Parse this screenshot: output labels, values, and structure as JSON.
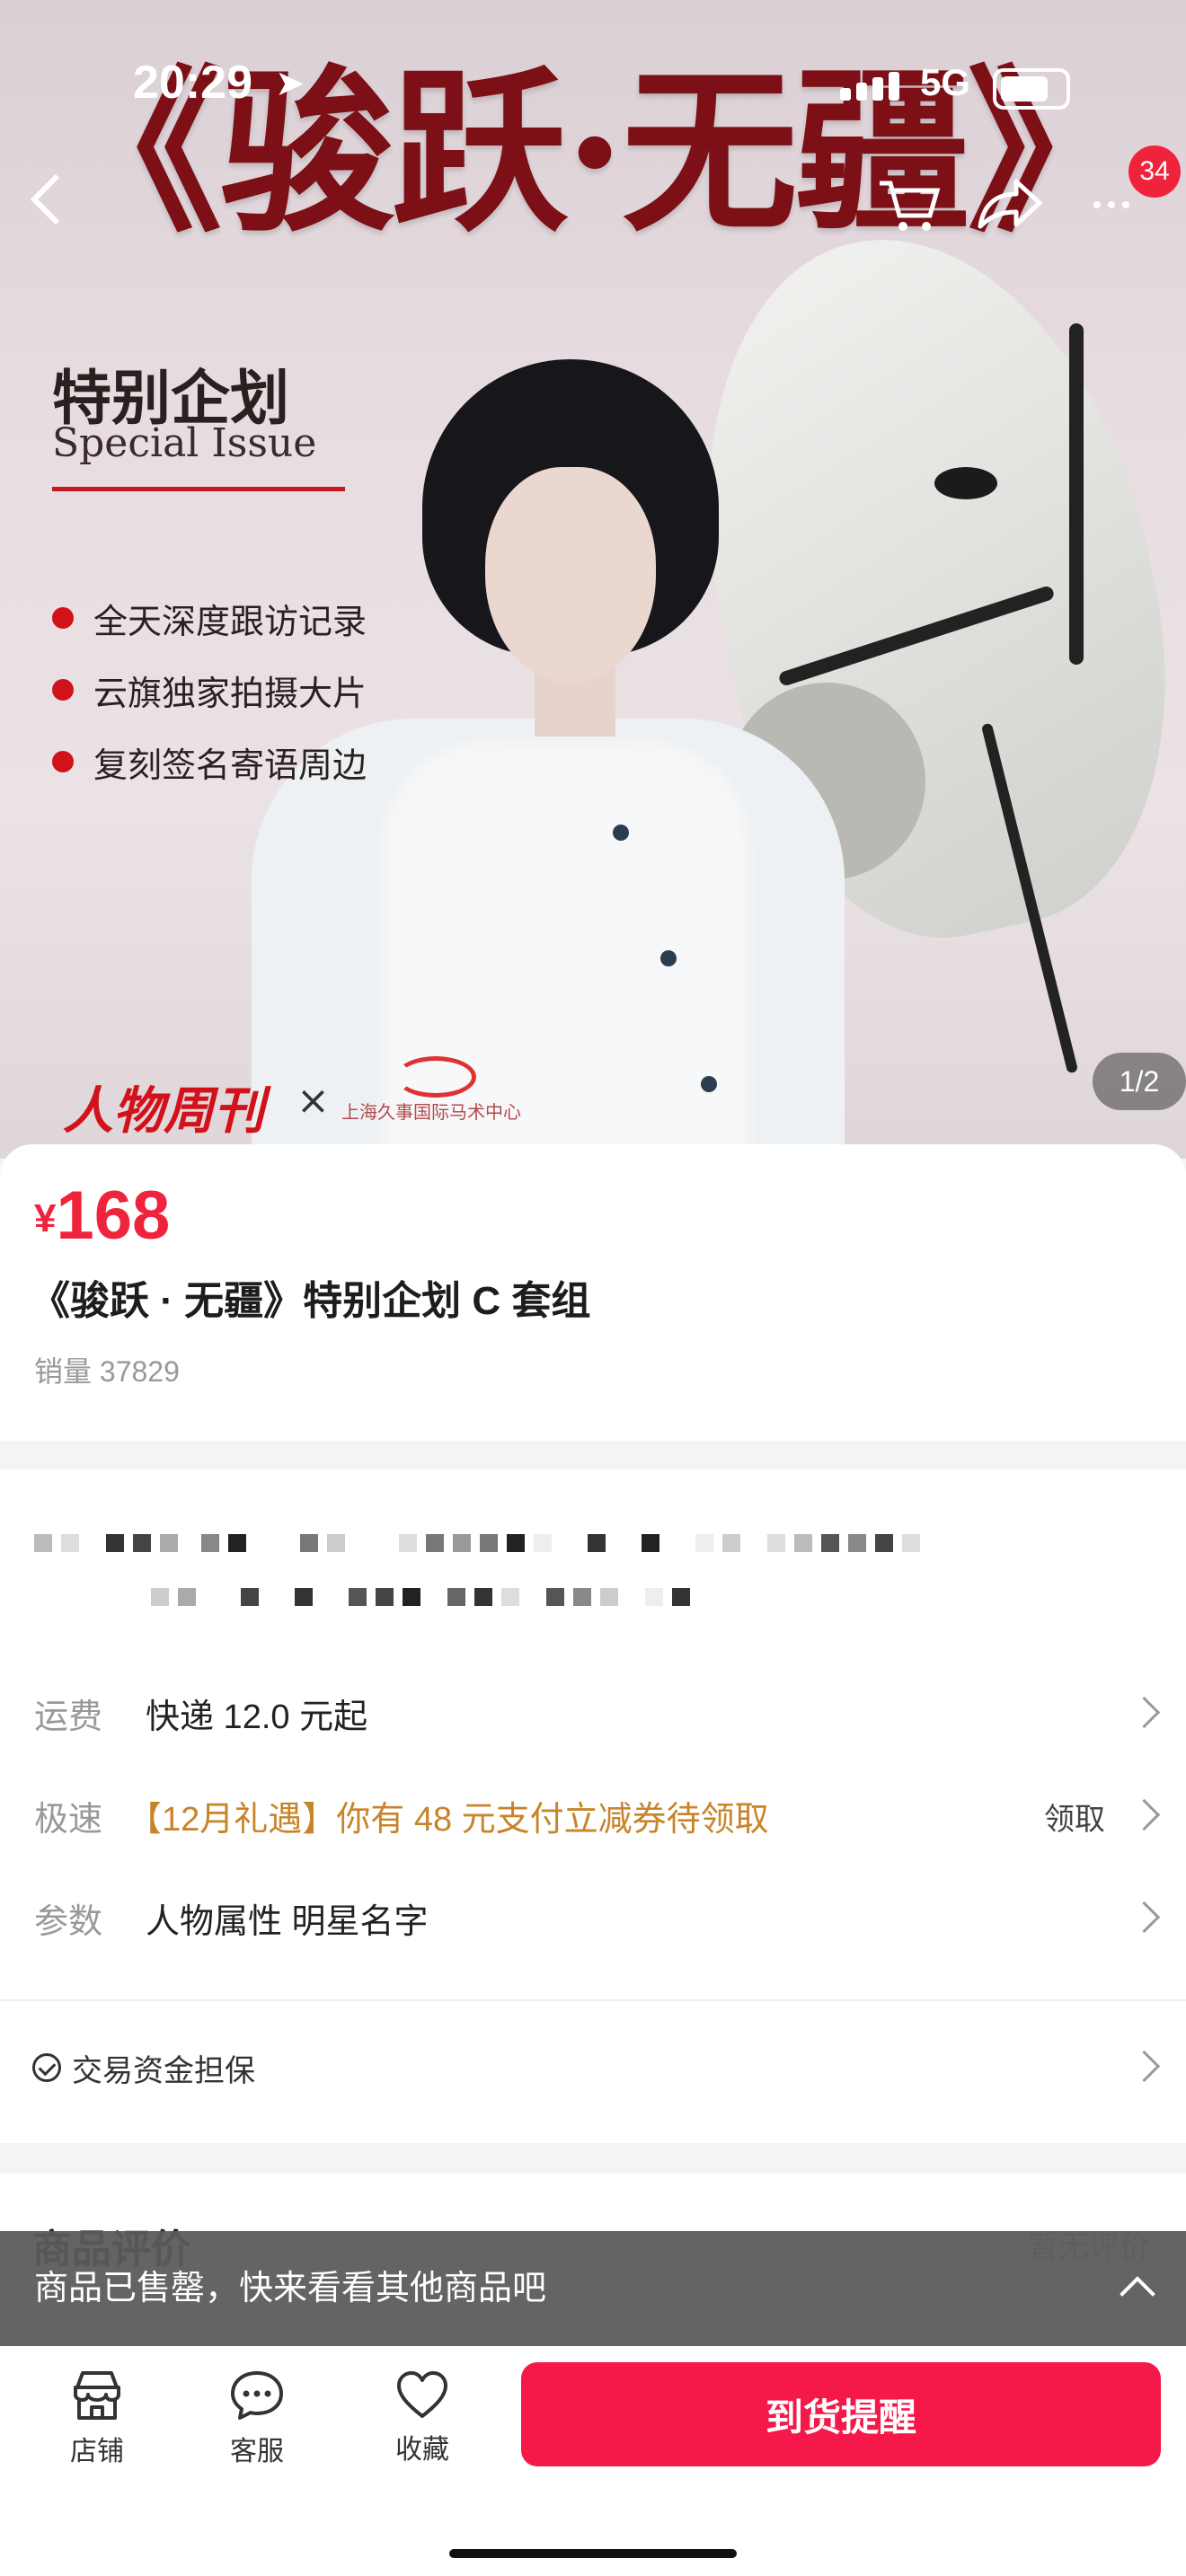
{
  "status_bar": {
    "time": "20:29",
    "network": "5G"
  },
  "nav": {
    "cart_badge": "34"
  },
  "hero": {
    "poster_title": "《骏跃·无疆》",
    "special_cn": "特别企划",
    "special_en": "Special Issue",
    "bullets": [
      "全天深度跟访记录",
      "云旗独家拍摄大片",
      "复刻签名寄语周边"
    ],
    "brand_left": "人物周刊",
    "brand_x": "×",
    "brand_right": "上海久事国际马术中心",
    "page_indicator": "1/2"
  },
  "product": {
    "currency": "¥",
    "price": "168",
    "title": "《骏跃 · 无疆》特别企划 C 套组",
    "sales": "销量 37829"
  },
  "info": {
    "shipping": {
      "label": "运费",
      "value": "快递 12.0 元起"
    },
    "promo": {
      "label": "极速",
      "value": "【12月礼遇】你有 48 元支付立减券待领取",
      "action": "领取"
    },
    "params": {
      "label": "参数",
      "value": "人物属性 明星名字"
    },
    "guarantee": "交易资金担保"
  },
  "reviews": {
    "title": "商品评价",
    "side": "暂无评价"
  },
  "soldout_banner": "商品已售罄，快来看看其他商品吧",
  "bottom_bar": {
    "shop": "店铺",
    "service": "客服",
    "favorite": "收藏",
    "notify_button": "到货提醒"
  },
  "colors": {
    "accent": "#f0233c",
    "button": "#f5194a",
    "promo": "#c8842a"
  }
}
